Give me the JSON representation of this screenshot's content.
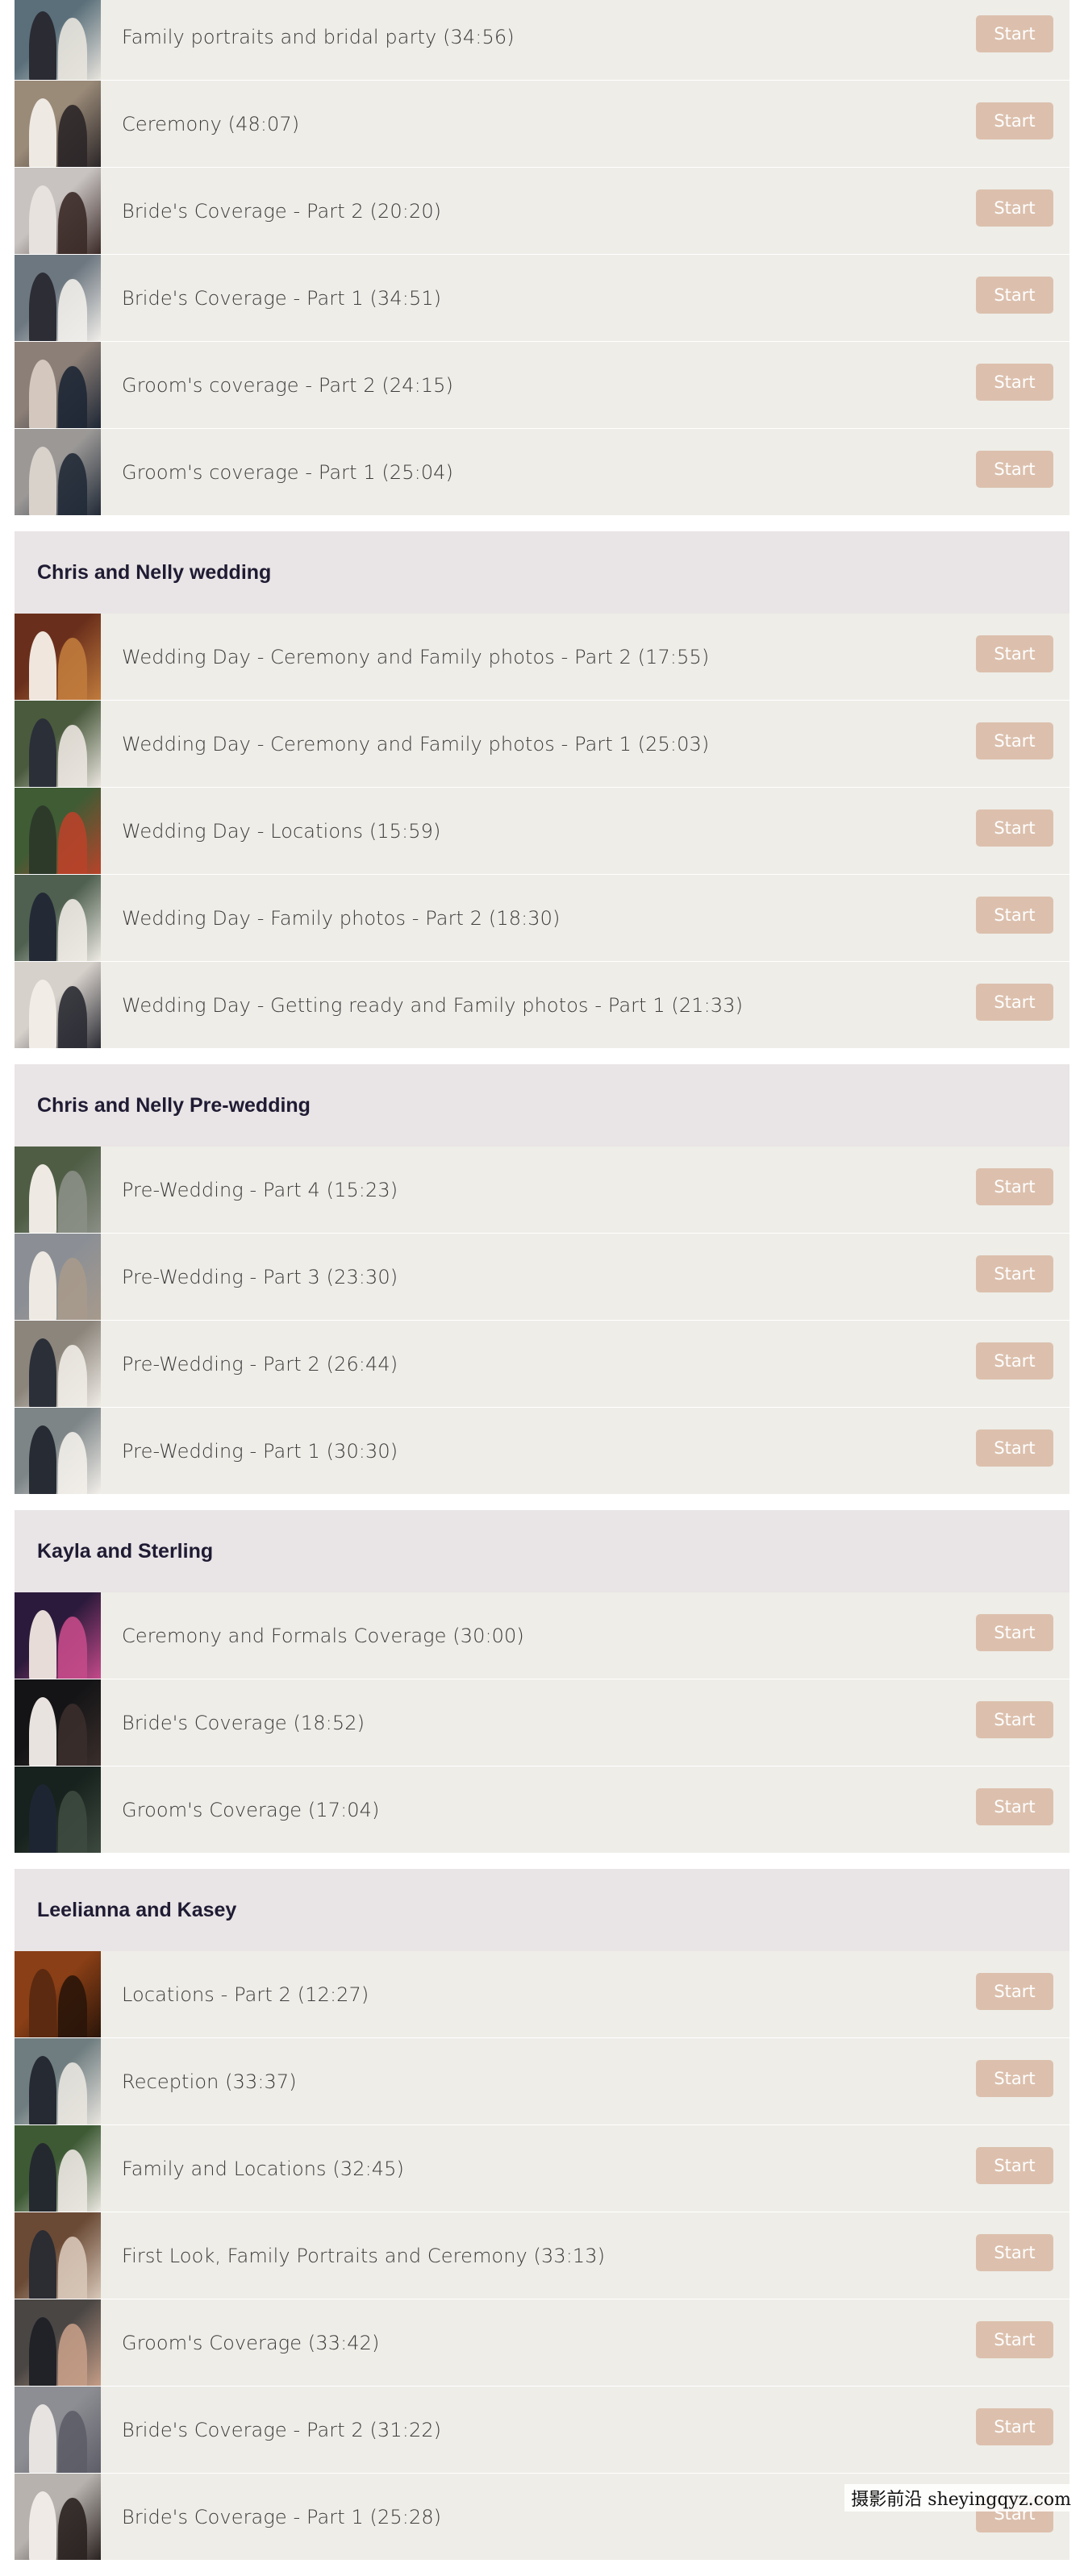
{
  "sections": [
    {
      "title": "",
      "items": [
        {
          "label": "Family portraits and bridal party (34:56)",
          "start": "Start",
          "colors": [
            "#5a6f7a",
            "#e8e4dd",
            "#2a2b33"
          ]
        },
        {
          "label": "Ceremony (48:07)",
          "start": "Start",
          "colors": [
            "#9a8a78",
            "#2b2628",
            "#efe9e3"
          ]
        },
        {
          "label": "Bride's Coverage - Part 2 (20:20)",
          "start": "Start",
          "colors": [
            "#c8c3c1",
            "#3b2a27",
            "#e8e2de"
          ]
        },
        {
          "label": "Bride's Coverage - Part 1 (34:51)",
          "start": "Start",
          "colors": [
            "#6d7780",
            "#f1eeea",
            "#2c2d35"
          ]
        },
        {
          "label": "Groom's coverage - Part 2 (24:15)",
          "start": "Start",
          "colors": [
            "#8c7f77",
            "#1e2735",
            "#d4c8be"
          ]
        },
        {
          "label": "Groom's coverage - Part 1 (25:04)",
          "start": "Start",
          "colors": [
            "#9b9896",
            "#212a37",
            "#d9d2cb"
          ]
        }
      ]
    },
    {
      "title": "Chris and Nelly wedding",
      "items": [
        {
          "label": "Wedding Day - Ceremony and Family photos - Part 2 (17:55)",
          "start": "Start",
          "colors": [
            "#6a2f1c",
            "#c07b3c",
            "#f0e6de"
          ]
        },
        {
          "label": "Wedding Day - Ceremony and Family photos - Part 1 (25:03)",
          "start": "Start",
          "colors": [
            "#4a5a3d",
            "#ebe6e0",
            "#2b2f38"
          ]
        },
        {
          "label": "Wedding Day - Locations (15:59)",
          "start": "Start",
          "colors": [
            "#3f5c35",
            "#b8432a",
            "#2d3a2a"
          ]
        },
        {
          "label": "Wedding Day - Family photos - Part 2 (18:30)",
          "start": "Start",
          "colors": [
            "#4f6050",
            "#eeeae4",
            "#232a36"
          ]
        },
        {
          "label": "Wedding Day - Getting ready and Family photos - Part 1 (21:33)",
          "start": "Start",
          "colors": [
            "#d7d1cb",
            "#2a2b33",
            "#f1ece6"
          ]
        }
      ]
    },
    {
      "title": "Chris and Nelly Pre-wedding",
      "items": [
        {
          "label": "Pre-Wedding - Part 4 (15:23)",
          "start": "Start",
          "colors": [
            "#4f5d45",
            "#8b8f86",
            "#eeeae3"
          ]
        },
        {
          "label": "Pre-Wedding - Part 3 (23:30)",
          "start": "Start",
          "colors": [
            "#8b8f95",
            "#a79a8c",
            "#eeeae3"
          ]
        },
        {
          "label": "Pre-Wedding - Part 2 (26:44)",
          "start": "Start",
          "colors": [
            "#8c857c",
            "#f0ece6",
            "#2b2f38"
          ]
        },
        {
          "label": "Pre-Wedding - Part 1 (30:30)",
          "start": "Start",
          "colors": [
            "#7d8587",
            "#f3efea",
            "#262b34"
          ]
        }
      ]
    },
    {
      "title": "Kayla and Sterling",
      "items": [
        {
          "label": "Ceremony and Formals Coverage (30:00)",
          "start": "Start",
          "colors": [
            "#2b1a3b",
            "#c44a8a",
            "#e8dcd8"
          ]
        },
        {
          "label": "Bride's Coverage (18:52)",
          "start": "Start",
          "colors": [
            "#141416",
            "#3a2e2b",
            "#e9e3df"
          ]
        },
        {
          "label": "Groom's Coverage (17:04)",
          "start": "Start",
          "colors": [
            "#17211d",
            "#3d4a3f",
            "#1e2532"
          ]
        }
      ]
    },
    {
      "title": "Leelianna and Kasey",
      "items": [
        {
          "label": "Locations - Part 2 (12:27)",
          "start": "Start",
          "colors": [
            "#8a3f16",
            "#2a1509",
            "#5c2a10"
          ]
        },
        {
          "label": "Reception (33:37)",
          "start": "Start",
          "colors": [
            "#6f7d80",
            "#e9e5df",
            "#262a33"
          ]
        },
        {
          "label": "Family and Locations (32:45)",
          "start": "Start",
          "colors": [
            "#3e5a35",
            "#ebe7e1",
            "#24292f"
          ]
        },
        {
          "label": "First Look, Family Portraits and Ceremony (33:13)",
          "start": "Start",
          "colors": [
            "#6a4a35",
            "#d8c7b8",
            "#2c2c33"
          ]
        },
        {
          "label": "Groom's Coverage (33:42)",
          "start": "Start",
          "colors": [
            "#4a4644",
            "#c49c86",
            "#202227"
          ]
        },
        {
          "label": "Bride's Coverage - Part 2 (31:22)",
          "start": "Start",
          "colors": [
            "#8d8e93",
            "#5d5d68",
            "#e6e3e0"
          ]
        },
        {
          "label": "Bride's Coverage - Part 1 (25:28)",
          "start": "Start",
          "colors": [
            "#b7b2ad",
            "#2a2220",
            "#efeae5"
          ]
        }
      ]
    }
  ],
  "watermark": "摄影前沿 sheyingqyz.com"
}
